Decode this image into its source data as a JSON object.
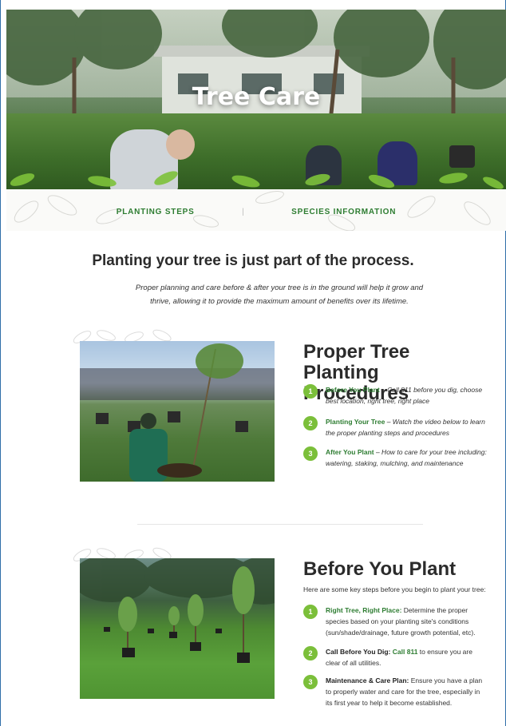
{
  "hero": {
    "title": "Tree Care"
  },
  "nav": {
    "links": [
      "PLANTING STEPS",
      "SPECIES INFORMATION"
    ],
    "separator": "|"
  },
  "intro": {
    "title": "Planting your tree is just part of the process.",
    "text": "Proper planning and care before & after your tree is in the ground will help it grow and thrive, allowing it to provide the maximum amount of benefits over its lifetime."
  },
  "section1": {
    "title": "Proper Tree Planting Procedures",
    "steps": [
      {
        "num": "1",
        "head": "Before You Plant",
        "desc": " – Call 811 before you dig, choose best location, right tree, right place"
      },
      {
        "num": "2",
        "head": "Planting Your Tree",
        "desc": " – Watch the video below to learn the proper planting steps and procedures"
      },
      {
        "num": "3",
        "head": "After You Plant",
        "desc": " – How to care for your tree including: watering, staking, mulching, and maintenance"
      }
    ]
  },
  "section2": {
    "title": "Before You Plant",
    "intro": "Here are some key steps before you begin to plant your tree:",
    "steps": [
      {
        "num": "1",
        "head": "Right Tree, Right Place:",
        "desc": " Determine the proper species based on your planting site's conditions (sun/shade/drainage, future growth potential, etc)."
      },
      {
        "num": "2",
        "head": "Call Before You Dig:",
        "link": "Call 811",
        "desc": " to ensure you are clear of all utilities."
      },
      {
        "num": "3",
        "head": "Maintenance & Care Plan:",
        "desc": " Ensure you have a plan to properly water and care for the tree, especially in its first year to help it become established."
      }
    ]
  },
  "colors": {
    "accent_green": "#2e7d32",
    "badge_green": "#7bbf3a",
    "frame_blue": "#2f6fa8"
  }
}
